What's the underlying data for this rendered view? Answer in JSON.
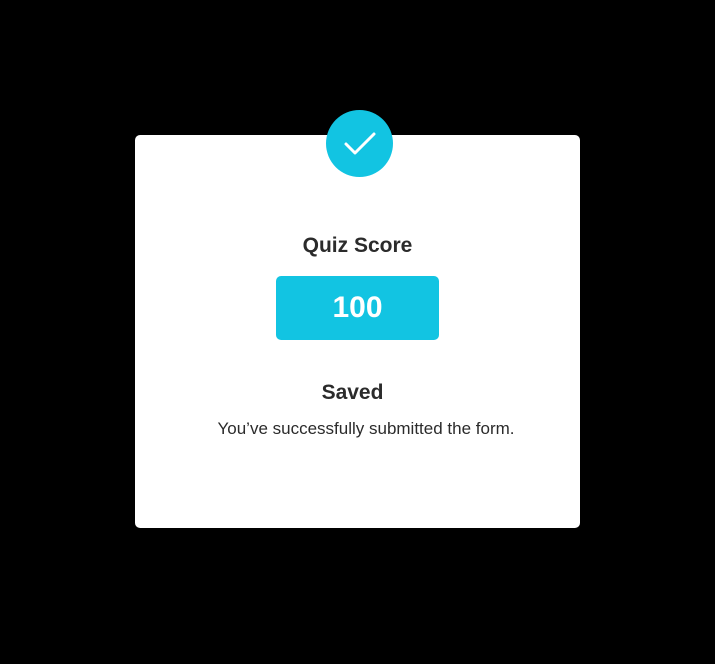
{
  "dialog": {
    "icon": "checkmark-icon",
    "quiz_label": "Quiz Score",
    "score": "100",
    "status_title": "Saved",
    "status_message": "You’ve successfully submitted the form."
  },
  "colors": {
    "backdrop": "#000000",
    "card": "#ffffff",
    "accent": "#12c4e2",
    "text": "#2b2b2b"
  }
}
